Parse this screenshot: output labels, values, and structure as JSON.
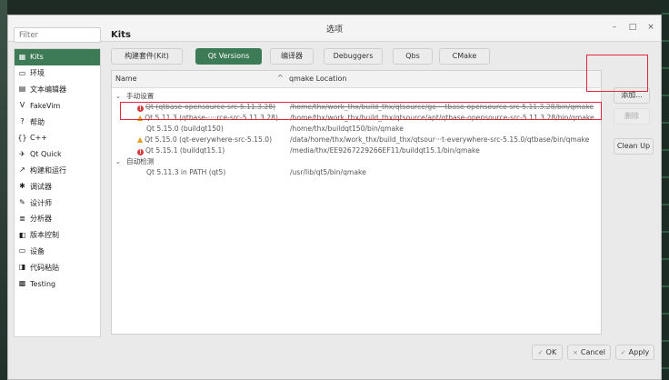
{
  "window": {
    "title": "选项",
    "minimize": "–",
    "maximize": "□",
    "close": "×"
  },
  "filter": {
    "placeholder": "Filter"
  },
  "sidebar": {
    "items": [
      {
        "label": "Kits",
        "icon": "kits-icon",
        "glyph": "▦"
      },
      {
        "label": "环境",
        "icon": "monitor-icon",
        "glyph": "▭"
      },
      {
        "label": "文本编辑器",
        "icon": "text-editor-icon",
        "glyph": "▤"
      },
      {
        "label": "FakeVim",
        "icon": "fakevim-icon",
        "glyph": "V"
      },
      {
        "label": "帮助",
        "icon": "help-icon",
        "glyph": "?"
      },
      {
        "label": "C++",
        "icon": "cpp-icon",
        "glyph": "{}"
      },
      {
        "label": "Qt Quick",
        "icon": "qtquick-icon",
        "glyph": "✈"
      },
      {
        "label": "构建和运行",
        "icon": "build-run-icon",
        "glyph": "↗"
      },
      {
        "label": "调试器",
        "icon": "debugger-icon",
        "glyph": "✱"
      },
      {
        "label": "设计师",
        "icon": "designer-icon",
        "glyph": "✎"
      },
      {
        "label": "分析器",
        "icon": "analyzer-icon",
        "glyph": "≣"
      },
      {
        "label": "版本控制",
        "icon": "version-control-icon",
        "glyph": "◧"
      },
      {
        "label": "设备",
        "icon": "devices-icon",
        "glyph": "▭"
      },
      {
        "label": "代码粘贴",
        "icon": "code-paste-icon",
        "glyph": "◨"
      },
      {
        "label": "Testing",
        "icon": "testing-icon",
        "glyph": "▩"
      }
    ]
  },
  "content": {
    "heading": "Kits",
    "tabs": [
      "构建套件(Kit)",
      "Qt Versions",
      "编译器",
      "Debuggers",
      "Qbs",
      "CMake"
    ],
    "table": {
      "col_name": "Name",
      "col_location": "qmake Location",
      "sort_glyph": "^",
      "groups": [
        {
          "label": "手动设置",
          "rows": [
            {
              "status": "error",
              "name": "Qt (qtbase-opensource-src-5.11.3.28)",
              "location": "/home/thx/work_thx/build_thx/qtsource/ge····tbase-opensource-src-5.11.3.28/bin/qmake",
              "strike": true
            },
            {
              "status": "warning",
              "name": "Qt 5.11.3 (qtbase-····rce-src-5.11.3.28)",
              "location": "/home/thx/work_thx/build_thx/qtsource/apt/qtbase-opensource-src-5.11.3.28/bin/qmake",
              "strike": false
            },
            {
              "status": "none",
              "name": "Qt 5.15.0 (buildqt150)",
              "location": "/home/thx/buildqt150/bin/qmake",
              "strike": false
            },
            {
              "status": "warning",
              "name": "Qt 5.15.0 (qt-everywhere-src-5.15.0)",
              "location": "/data/home/thx/work_thx/build_thx/qtsour···t-everywhere-src-5.15.0/qtbase/bin/qmake",
              "strike": false
            },
            {
              "status": "error",
              "name": "Qt 5.15.1 (buildqt15.1)",
              "location": "/media/thx/EE9267229266EF11/buildqt15.1/bin/qmake",
              "strike": false
            }
          ]
        },
        {
          "label": "自动检测",
          "rows": [
            {
              "status": "none",
              "name": "Qt 5.11.3 in PATH (qt5)",
              "location": "/usr/lib/qt5/bin/qmake",
              "strike": false
            }
          ]
        }
      ]
    },
    "buttons": {
      "add": "添加...",
      "remove": "删除",
      "cleanup": "Clean Up"
    }
  },
  "footer": {
    "ok": "OK",
    "cancel": "Cancel",
    "apply": "Apply",
    "check_glyph": "✓",
    "x_glyph": "×"
  },
  "colors": {
    "accent": "#3d7a56",
    "highlight": "#e3263c",
    "error": "#d63b3b",
    "warning": "#e1a11e"
  }
}
